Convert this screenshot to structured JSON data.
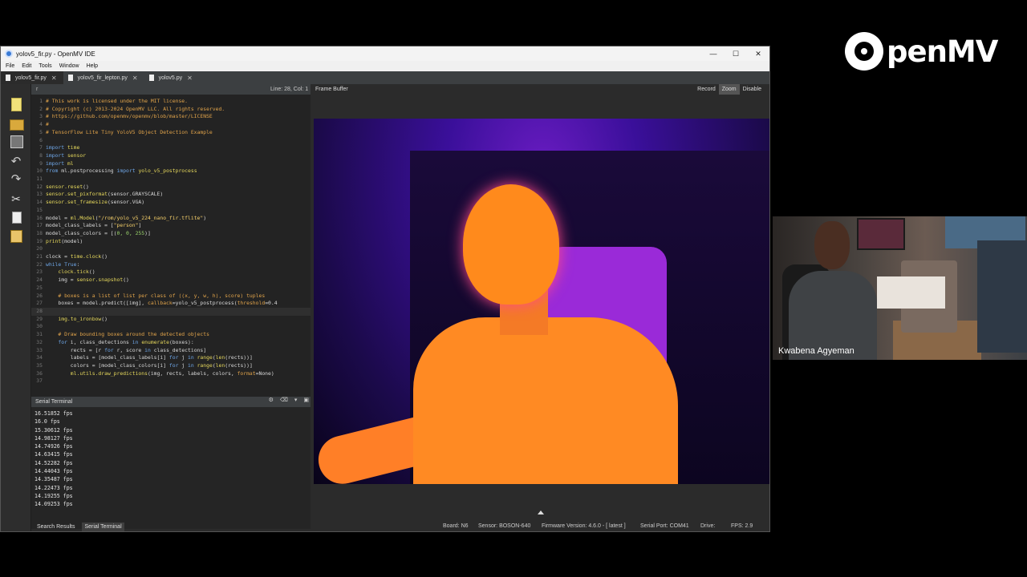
{
  "window": {
    "title": "yolov5_fir.py - OpenMV IDE",
    "controls": [
      "—",
      "☐",
      "✕"
    ]
  },
  "menu": [
    "File",
    "Edit",
    "Tools",
    "Window",
    "Help"
  ],
  "tabs": [
    {
      "label": "yolov5_fir.py",
      "active": true
    },
    {
      "label": "yolov5_fir_lepton.py",
      "active": false
    },
    {
      "label": "yolov5.py",
      "active": false
    }
  ],
  "editor": {
    "header_symbol": "r",
    "position": "Line: 28, Col: 1",
    "lines": [
      {
        "n": "1",
        "segments": [
          [
            "c-com",
            "# This work is licensed under the MIT license."
          ]
        ]
      },
      {
        "n": "2",
        "segments": [
          [
            "c-com",
            "# Copyright (c) 2013-2024 OpenMV LLC. All rights reserved."
          ]
        ]
      },
      {
        "n": "3",
        "segments": [
          [
            "c-com",
            "# https://github.com/openmv/openmv/blob/master/LICENSE"
          ]
        ]
      },
      {
        "n": "4",
        "segments": [
          [
            "c-com",
            "#"
          ]
        ]
      },
      {
        "n": "5",
        "segments": [
          [
            "c-com",
            "# TensorFlow Lite Tiny YoloV5 Object Detection Example"
          ]
        ]
      },
      {
        "n": "6",
        "segments": []
      },
      {
        "n": "7",
        "segments": [
          [
            "c-kw",
            "import"
          ],
          [
            "",
            " "
          ],
          [
            "c-fn",
            "time"
          ]
        ]
      },
      {
        "n": "8",
        "segments": [
          [
            "c-kw",
            "import"
          ],
          [
            "",
            " "
          ],
          [
            "c-fn",
            "sensor"
          ]
        ]
      },
      {
        "n": "9",
        "segments": [
          [
            "c-kw",
            "import"
          ],
          [
            "",
            " "
          ],
          [
            "c-fn",
            "ml"
          ]
        ]
      },
      {
        "n": "10",
        "segments": [
          [
            "c-kw",
            "from"
          ],
          [
            "",
            " ml.postprocessing "
          ],
          [
            "c-kw",
            "import"
          ],
          [
            "c-fn",
            " yolo_v5_postprocess"
          ]
        ]
      },
      {
        "n": "11",
        "segments": []
      },
      {
        "n": "12",
        "segments": [
          [
            "c-fn",
            "sensor.reset"
          ],
          [
            "",
            "()"
          ]
        ]
      },
      {
        "n": "13",
        "segments": [
          [
            "c-fn",
            "sensor.set_pixformat"
          ],
          [
            "",
            "(sensor.GRAYSCALE)"
          ]
        ]
      },
      {
        "n": "14",
        "segments": [
          [
            "c-fn",
            "sensor.set_framesize"
          ],
          [
            "",
            "(sensor.VGA)"
          ]
        ]
      },
      {
        "n": "15",
        "segments": []
      },
      {
        "n": "16",
        "segments": [
          [
            "",
            "model = "
          ],
          [
            "c-fn",
            "ml.Model"
          ],
          [
            "",
            "("
          ],
          [
            "c-str",
            "\"/rom/yolo_v5_224_nano_fir.tflite\""
          ],
          [
            "",
            ")"
          ]
        ]
      },
      {
        "n": "17",
        "segments": [
          [
            "",
            "model_class_labels = ["
          ],
          [
            "c-str",
            "\"person\""
          ],
          [
            "",
            "]"
          ]
        ]
      },
      {
        "n": "18",
        "segments": [
          [
            "",
            "model_class_colors = [("
          ],
          [
            "c-num",
            "0, 0, 255"
          ],
          [
            "",
            ")]"
          ]
        ]
      },
      {
        "n": "19",
        "segments": [
          [
            "c-fn",
            "print"
          ],
          [
            "",
            "(model)"
          ]
        ]
      },
      {
        "n": "20",
        "segments": []
      },
      {
        "n": "21",
        "segments": [
          [
            "",
            "clock = "
          ],
          [
            "c-fn",
            "time.clock"
          ],
          [
            "",
            "()"
          ]
        ]
      },
      {
        "n": "22",
        "segments": [
          [
            "c-kw",
            "while"
          ],
          [
            "",
            " "
          ],
          [
            "c-kw",
            "True"
          ],
          [
            "",
            ":"
          ]
        ]
      },
      {
        "n": "23",
        "segments": [
          [
            "",
            "    "
          ],
          [
            "c-fn",
            "clock.tick"
          ],
          [
            "",
            "()"
          ]
        ]
      },
      {
        "n": "24",
        "segments": [
          [
            "",
            "    img = "
          ],
          [
            "c-fn",
            "sensor.snapshot"
          ],
          [
            "",
            "()"
          ]
        ]
      },
      {
        "n": "25",
        "segments": []
      },
      {
        "n": "26",
        "segments": [
          [
            "",
            "    "
          ],
          [
            "c-com",
            "# boxes is a list of list per class of ((x, y, w, h), score) tuples"
          ]
        ]
      },
      {
        "n": "27",
        "segments": [
          [
            "",
            "    boxes = model.predict([img], "
          ],
          [
            "c-com",
            "callback"
          ],
          [
            "",
            "=yolo_v5_postprocess("
          ],
          [
            "c-com",
            "threshold"
          ],
          [
            "",
            "=0.4"
          ]
        ]
      },
      {
        "n": "28",
        "segments": [],
        "hl": true
      },
      {
        "n": "29",
        "segments": [
          [
            "",
            "    "
          ],
          [
            "c-fn",
            "img.to_ironbow"
          ],
          [
            "",
            "()"
          ]
        ]
      },
      {
        "n": "30",
        "segments": []
      },
      {
        "n": "31",
        "segments": [
          [
            "",
            "    "
          ],
          [
            "c-com",
            "# Draw bounding boxes around the detected objects"
          ]
        ]
      },
      {
        "n": "32",
        "segments": [
          [
            "",
            "    "
          ],
          [
            "c-kw",
            "for"
          ],
          [
            "",
            " i, class_detections "
          ],
          [
            "c-kw",
            "in"
          ],
          [
            "",
            " "
          ],
          [
            "c-fn",
            "enumerate"
          ],
          [
            "",
            "(boxes):"
          ]
        ]
      },
      {
        "n": "33",
        "segments": [
          [
            "",
            "        rects = [r "
          ],
          [
            "c-kw",
            "for"
          ],
          [
            "",
            " r, score "
          ],
          [
            "c-kw",
            "in"
          ],
          [
            "",
            " class_detections]"
          ]
        ]
      },
      {
        "n": "34",
        "segments": [
          [
            "",
            "        labels = [model_class_labels[i] "
          ],
          [
            "c-kw",
            "for"
          ],
          [
            "",
            " j "
          ],
          [
            "c-kw",
            "in"
          ],
          [
            "",
            " "
          ],
          [
            "c-fn",
            "range"
          ],
          [
            "",
            "("
          ],
          [
            "c-fn",
            "len"
          ],
          [
            "",
            "(rects))]"
          ]
        ]
      },
      {
        "n": "35",
        "segments": [
          [
            "",
            "        colors = [model_class_colors[i] "
          ],
          [
            "c-kw",
            "for"
          ],
          [
            "",
            " j "
          ],
          [
            "c-kw",
            "in"
          ],
          [
            "",
            " "
          ],
          [
            "c-fn",
            "range"
          ],
          [
            "",
            "("
          ],
          [
            "c-fn",
            "len"
          ],
          [
            "",
            "(rects))]"
          ]
        ]
      },
      {
        "n": "36",
        "segments": [
          [
            "",
            "        "
          ],
          [
            "c-fn",
            "ml.utils.draw_predictions"
          ],
          [
            "",
            "(img, rects, labels, colors, "
          ],
          [
            "c-com",
            "format"
          ],
          [
            "",
            "=None)"
          ]
        ]
      },
      {
        "n": "37",
        "segments": []
      }
    ]
  },
  "framebuffer": {
    "label": "Frame Buffer",
    "buttons": [
      "Record",
      "Zoom",
      "Disable"
    ],
    "active_button": "Zoom"
  },
  "terminal": {
    "title": "Serial Terminal",
    "lines": [
      "16.51852 fps",
      "16.0 fps",
      "15.30612 fps",
      "14.98127 fps",
      "14.74926 fps",
      "14.63415 fps",
      "14.52282 fps",
      "14.44043 fps",
      "14.35487 fps",
      "14.22473 fps",
      "14.19255 fps",
      "14.09253 fps"
    ]
  },
  "bottom_tabs": [
    {
      "label": "Search Results",
      "active": false
    },
    {
      "label": "Serial Terminal",
      "active": true
    }
  ],
  "status": {
    "board": "Board: N6",
    "sensor": "Sensor: BOSON-640",
    "firmware": "Firmware Version: 4.6.0 - [ latest ]",
    "serial_port": "Serial Port: COM41",
    "drive": "Drive:",
    "fps": "FPS:  2.9"
  },
  "brand": {
    "logo_text": "penMV"
  },
  "webcam": {
    "name": "Kwabena Agyeman"
  }
}
